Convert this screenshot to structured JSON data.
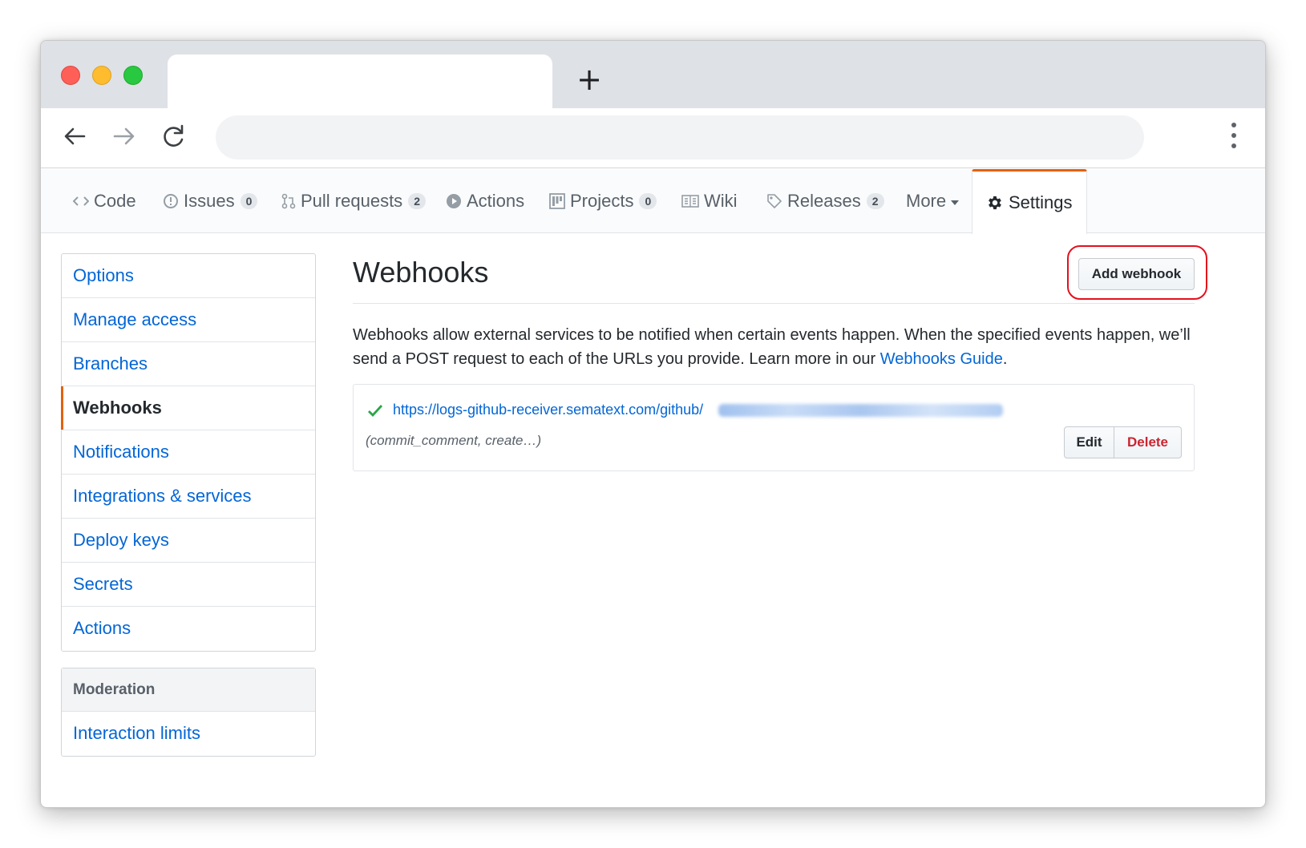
{
  "browser": {
    "new_tab_symbol": "+"
  },
  "repo_nav": {
    "tabs": [
      {
        "label": "Code",
        "icon": "code-icon"
      },
      {
        "label": "Issues",
        "icon": "issue-icon",
        "count": "0"
      },
      {
        "label": "Pull requests",
        "icon": "pull-request-icon",
        "count": "2"
      },
      {
        "label": "Actions",
        "icon": "play-icon"
      },
      {
        "label": "Projects",
        "icon": "project-icon",
        "count": "0"
      },
      {
        "label": "Wiki",
        "icon": "book-icon"
      },
      {
        "label": "Releases",
        "icon": "tag-icon",
        "count": "2"
      },
      {
        "label": "More",
        "icon": "caret-down-icon"
      },
      {
        "label": "Settings",
        "icon": "gear-icon"
      }
    ],
    "selected": "Settings"
  },
  "sidebar": {
    "items": [
      {
        "label": "Options"
      },
      {
        "label": "Manage access"
      },
      {
        "label": "Branches"
      },
      {
        "label": "Webhooks"
      },
      {
        "label": "Notifications"
      },
      {
        "label": "Integrations & services"
      },
      {
        "label": "Deploy keys"
      },
      {
        "label": "Secrets"
      },
      {
        "label": "Actions"
      }
    ],
    "selected": "Webhooks",
    "moderation": {
      "heading": "Moderation",
      "items": [
        {
          "label": "Interaction limits"
        }
      ]
    }
  },
  "main": {
    "title": "Webhooks",
    "add_button": "Add webhook",
    "description": "Webhooks allow external services to be notified when certain events happen. When the specified events happen, we’ll send a POST request to each of the URLs you provide. Learn more in our ",
    "guide_link": "Webhooks Guide",
    "description_end": ".",
    "hooks": [
      {
        "url": "https://logs-github-receiver.sematext.com/github/",
        "events": "(commit_comment, create…)",
        "status": "success",
        "edit_label": "Edit",
        "delete_label": "Delete"
      }
    ]
  },
  "colors": {
    "accent": "#e36209",
    "link": "#0366d6",
    "danger": "#cb2431",
    "success": "#28a745",
    "highlight_ring": "#e5101d"
  }
}
